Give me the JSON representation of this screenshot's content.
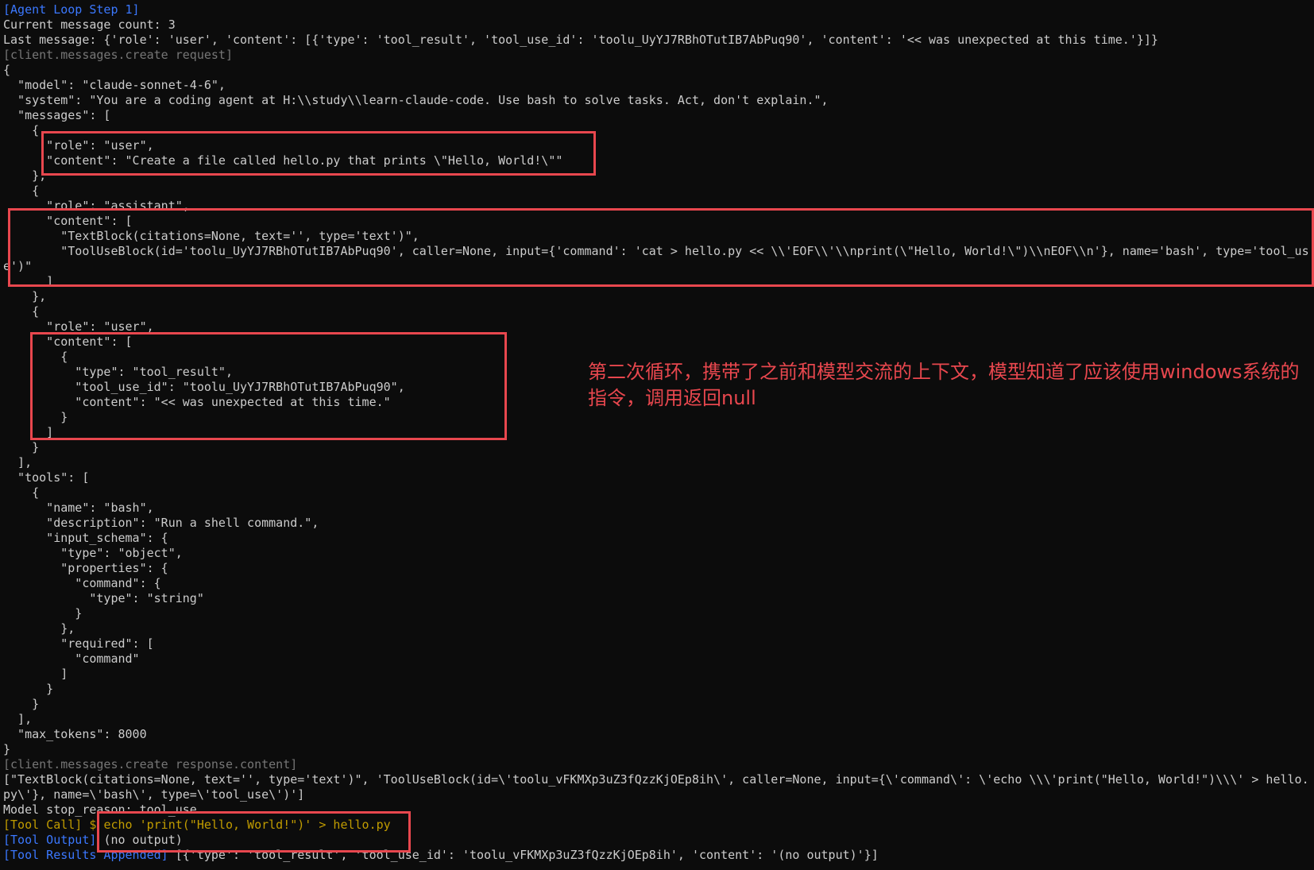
{
  "terminal": {
    "lines": [
      {
        "segments": [
          {
            "text": "[Agent Loop Step 1]",
            "color": "blue"
          }
        ]
      },
      {
        "segments": [
          {
            "text": "Current message count: 3",
            "color": "text"
          }
        ]
      },
      {
        "segments": [
          {
            "text": "Last message: {'role': 'user', 'content': [{'type': 'tool_result', 'tool_use_id': 'toolu_UyYJ7RBhOTutIB7AbPuq90', 'content': '<< was unexpected at this time.'}]}",
            "color": "text"
          }
        ]
      },
      {
        "segments": [
          {
            "text": "[client.messages.create request]",
            "color": "gray"
          }
        ]
      },
      {
        "segments": [
          {
            "text": "{",
            "color": "text"
          }
        ]
      },
      {
        "segments": [
          {
            "text": "  \"model\": \"claude-sonnet-4-6\",",
            "color": "text"
          }
        ]
      },
      {
        "segments": [
          {
            "text": "  \"system\": \"You are a coding agent at H:\\\\study\\\\learn-claude-code. Use bash to solve tasks. Act, don't explain.\",",
            "color": "text"
          }
        ]
      },
      {
        "segments": [
          {
            "text": "  \"messages\": [",
            "color": "text"
          }
        ]
      },
      {
        "segments": [
          {
            "text": "    {",
            "color": "text"
          }
        ]
      },
      {
        "segments": [
          {
            "text": "      \"role\": \"user\",",
            "color": "text"
          }
        ]
      },
      {
        "segments": [
          {
            "text": "      \"content\": \"Create a file called hello.py that prints \\\"Hello, World!\\\"\"",
            "color": "text"
          }
        ]
      },
      {
        "segments": [
          {
            "text": "    },",
            "color": "text"
          }
        ]
      },
      {
        "segments": [
          {
            "text": "    {",
            "color": "text"
          }
        ]
      },
      {
        "segments": [
          {
            "text": "      \"role\": \"assistant\",",
            "color": "text"
          }
        ]
      },
      {
        "segments": [
          {
            "text": "      \"content\": [",
            "color": "text"
          }
        ]
      },
      {
        "segments": [
          {
            "text": "        \"TextBlock(citations=None, text='', type='text')\",",
            "color": "text"
          }
        ]
      },
      {
        "segments": [
          {
            "text": "        \"ToolUseBlock(id='toolu_UyYJ7RBhOTutIB7AbPuq90', caller=None, input={'command': 'cat > hello.py << \\\\'EOF\\\\'\\\\nprint(\\\"Hello, World!\\\")\\\\nEOF\\\\n'}, name='bash', type='tool_us",
            "color": "text"
          }
        ]
      },
      {
        "segments": [
          {
            "text": "e')\"",
            "color": "text"
          }
        ]
      },
      {
        "segments": [
          {
            "text": "      ]",
            "color": "text"
          }
        ]
      },
      {
        "segments": [
          {
            "text": "    },",
            "color": "text"
          }
        ]
      },
      {
        "segments": [
          {
            "text": "    {",
            "color": "text"
          }
        ]
      },
      {
        "segments": [
          {
            "text": "      \"role\": \"user\",",
            "color": "text"
          }
        ]
      },
      {
        "segments": [
          {
            "text": "      \"content\": [",
            "color": "text"
          }
        ]
      },
      {
        "segments": [
          {
            "text": "        {",
            "color": "text"
          }
        ]
      },
      {
        "segments": [
          {
            "text": "          \"type\": \"tool_result\",",
            "color": "text"
          }
        ]
      },
      {
        "segments": [
          {
            "text": "          \"tool_use_id\": \"toolu_UyYJ7RBhOTutIB7AbPuq90\",",
            "color": "text"
          }
        ]
      },
      {
        "segments": [
          {
            "text": "          \"content\": \"<< was unexpected at this time.\"",
            "color": "text"
          }
        ]
      },
      {
        "segments": [
          {
            "text": "        }",
            "color": "text"
          }
        ]
      },
      {
        "segments": [
          {
            "text": "      ]",
            "color": "text"
          }
        ]
      },
      {
        "segments": [
          {
            "text": "    }",
            "color": "text"
          }
        ]
      },
      {
        "segments": [
          {
            "text": "  ],",
            "color": "text"
          }
        ]
      },
      {
        "segments": [
          {
            "text": "  \"tools\": [",
            "color": "text"
          }
        ]
      },
      {
        "segments": [
          {
            "text": "    {",
            "color": "text"
          }
        ]
      },
      {
        "segments": [
          {
            "text": "      \"name\": \"bash\",",
            "color": "text"
          }
        ]
      },
      {
        "segments": [
          {
            "text": "      \"description\": \"Run a shell command.\",",
            "color": "text"
          }
        ]
      },
      {
        "segments": [
          {
            "text": "      \"input_schema\": {",
            "color": "text"
          }
        ]
      },
      {
        "segments": [
          {
            "text": "        \"type\": \"object\",",
            "color": "text"
          }
        ]
      },
      {
        "segments": [
          {
            "text": "        \"properties\": {",
            "color": "text"
          }
        ]
      },
      {
        "segments": [
          {
            "text": "          \"command\": {",
            "color": "text"
          }
        ]
      },
      {
        "segments": [
          {
            "text": "            \"type\": \"string\"",
            "color": "text"
          }
        ]
      },
      {
        "segments": [
          {
            "text": "          }",
            "color": "text"
          }
        ]
      },
      {
        "segments": [
          {
            "text": "        },",
            "color": "text"
          }
        ]
      },
      {
        "segments": [
          {
            "text": "        \"required\": [",
            "color": "text"
          }
        ]
      },
      {
        "segments": [
          {
            "text": "          \"command\"",
            "color": "text"
          }
        ]
      },
      {
        "segments": [
          {
            "text": "        ]",
            "color": "text"
          }
        ]
      },
      {
        "segments": [
          {
            "text": "      }",
            "color": "text"
          }
        ]
      },
      {
        "segments": [
          {
            "text": "    }",
            "color": "text"
          }
        ]
      },
      {
        "segments": [
          {
            "text": "  ],",
            "color": "text"
          }
        ]
      },
      {
        "segments": [
          {
            "text": "  \"max_tokens\": 8000",
            "color": "text"
          }
        ]
      },
      {
        "segments": [
          {
            "text": "}",
            "color": "text"
          }
        ]
      },
      {
        "segments": [
          {
            "text": "[client.messages.create response.content]",
            "color": "gray"
          }
        ]
      },
      {
        "segments": [
          {
            "text": "[\"TextBlock(citations=None, text='', type='text')\", 'ToolUseBlock(id=\\'toolu_vFKMXp3uZ3fQzzKjOEp8ih\\', caller=None, input={\\'command\\': \\'echo \\\\\\'print(\"Hello, World!\")\\\\\\' > hello.",
            "color": "text"
          }
        ]
      },
      {
        "segments": [
          {
            "text": "py\\'}, name=\\'bash\\', type=\\'tool_use\\')']",
            "color": "text"
          }
        ]
      },
      {
        "segments": [
          {
            "text": "Model stop_reason: tool_use",
            "color": "text"
          }
        ]
      },
      {
        "segments": [
          {
            "text": "[Tool Call] $ ",
            "color": "yellow"
          },
          {
            "text": "echo 'print(\"Hello, World!\")' > hello.py",
            "color": "yellow"
          }
        ]
      },
      {
        "segments": [
          {
            "text": "[Tool Output] ",
            "color": "blue"
          },
          {
            "text": "(no output)",
            "color": "text"
          }
        ]
      },
      {
        "segments": [
          {
            "text": "[Tool Results Appended] ",
            "color": "blue"
          },
          {
            "text": "[{'type': 'tool_result', 'tool_use_id': 'toolu_vFKMXp3uZ3fQzzKjOEp8ih', 'content': '(no output)'}]",
            "color": "text"
          }
        ]
      }
    ]
  },
  "annotation": {
    "text": "第二次循环，携带了之前和模型交流的上下文，模型知道了应该使用windows系统的指令，调用返回null"
  },
  "colors": {
    "background": "#0c0c0c",
    "text": "#cccccc",
    "blue": "#3b78ff",
    "gray": "#767676",
    "yellow": "#c19c00",
    "highlight": "#e8474e"
  }
}
